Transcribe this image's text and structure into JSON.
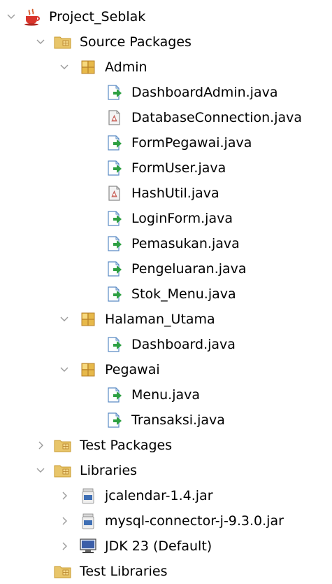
{
  "tree": {
    "rows": [
      {
        "level": 0,
        "type": "project",
        "label": "Project_Seblak",
        "expanded": true,
        "icon": "coffee-cup-project-icon",
        "name": "tree-node-project-seblak"
      },
      {
        "level": 1,
        "type": "folder",
        "label": "Source Packages",
        "expanded": true,
        "icon": "folder-package-icon",
        "name": "tree-node-source-packages"
      },
      {
        "level": 2,
        "type": "package",
        "label": "Admin",
        "expanded": true,
        "icon": "package-icon",
        "name": "tree-node-package-admin"
      },
      {
        "level": 3,
        "type": "form",
        "label": "DashboardAdmin.java",
        "icon": "java-form-icon",
        "name": "tree-node-dashboardadmin-java"
      },
      {
        "level": 3,
        "type": "class",
        "label": "DatabaseConnection.java",
        "icon": "java-class-icon",
        "name": "tree-node-databaseconnection-java"
      },
      {
        "level": 3,
        "type": "form",
        "label": "FormPegawai.java",
        "icon": "java-form-icon",
        "name": "tree-node-formpegawai-java"
      },
      {
        "level": 3,
        "type": "form",
        "label": "FormUser.java",
        "icon": "java-form-icon",
        "name": "tree-node-formuser-java"
      },
      {
        "level": 3,
        "type": "class",
        "label": "HashUtil.java",
        "icon": "java-class-icon",
        "name": "tree-node-hashutil-java"
      },
      {
        "level": 3,
        "type": "form",
        "label": "LoginForm.java",
        "icon": "java-form-icon",
        "name": "tree-node-loginform-java"
      },
      {
        "level": 3,
        "type": "form",
        "label": "Pemasukan.java",
        "icon": "java-form-icon",
        "name": "tree-node-pemasukan-java"
      },
      {
        "level": 3,
        "type": "form",
        "label": "Pengeluaran.java",
        "icon": "java-form-icon",
        "name": "tree-node-pengeluaran-java"
      },
      {
        "level": 3,
        "type": "form",
        "label": "Stok_Menu.java",
        "icon": "java-form-icon",
        "name": "tree-node-stok-menu-java"
      },
      {
        "level": 2,
        "type": "package",
        "label": "Halaman_Utama",
        "expanded": true,
        "icon": "package-icon",
        "name": "tree-node-package-halaman-utama"
      },
      {
        "level": 3,
        "type": "form",
        "label": "Dashboard.java",
        "icon": "java-form-icon",
        "name": "tree-node-dashboard-java"
      },
      {
        "level": 2,
        "type": "package",
        "label": "Pegawai",
        "expanded": true,
        "icon": "package-icon",
        "name": "tree-node-package-pegawai"
      },
      {
        "level": 3,
        "type": "form",
        "label": "Menu.java",
        "icon": "java-form-icon",
        "name": "tree-node-menu-java"
      },
      {
        "level": 3,
        "type": "form",
        "label": "Transaksi.java",
        "icon": "java-form-icon",
        "name": "tree-node-transaksi-java"
      },
      {
        "level": 1,
        "type": "folder",
        "label": "Test Packages",
        "expanded": false,
        "icon": "folder-package-icon",
        "name": "tree-node-test-packages"
      },
      {
        "level": 1,
        "type": "folder",
        "label": "Libraries",
        "expanded": true,
        "icon": "folder-library-icon",
        "name": "tree-node-libraries"
      },
      {
        "level": 2,
        "type": "jar",
        "label": "jcalendar-1.4.jar",
        "expanded": false,
        "icon": "jar-file-icon",
        "name": "tree-node-jcalendar-jar"
      },
      {
        "level": 2,
        "type": "jar",
        "label": "mysql-connector-j-9.3.0.jar",
        "expanded": false,
        "icon": "jar-file-icon",
        "name": "tree-node-mysql-connector-jar"
      },
      {
        "level": 2,
        "type": "jdk",
        "label": "JDK 23 (Default)",
        "expanded": false,
        "icon": "jdk-monitor-icon",
        "name": "tree-node-jdk-23"
      },
      {
        "level": 1,
        "type": "folder",
        "label": "Test Libraries",
        "icon": "folder-library-icon",
        "name": "tree-node-test-libraries"
      }
    ]
  },
  "colors": {
    "twisty": "#9a9a9a",
    "folder": "#e8c56a",
    "folder_dark": "#c99a2e",
    "package": "#e7b94a",
    "package_line": "#b7812a",
    "form_arrow": "#2ea043",
    "form_doc_border": "#5a8bc4",
    "class_doc_border": "#8a8a8a",
    "jar_blue": "#3f6fb4",
    "jdk_blue": "#3b5ea8"
  }
}
